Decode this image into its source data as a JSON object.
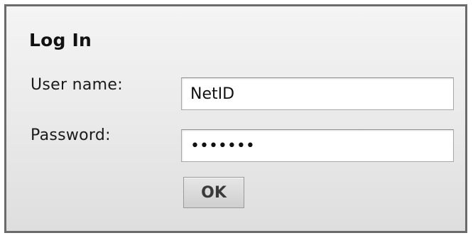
{
  "login": {
    "title": "Log In",
    "username_label": "User name:",
    "username_value": "NetID",
    "password_label": "Password:",
    "password_value": "•••••••",
    "submit_label": "OK"
  }
}
